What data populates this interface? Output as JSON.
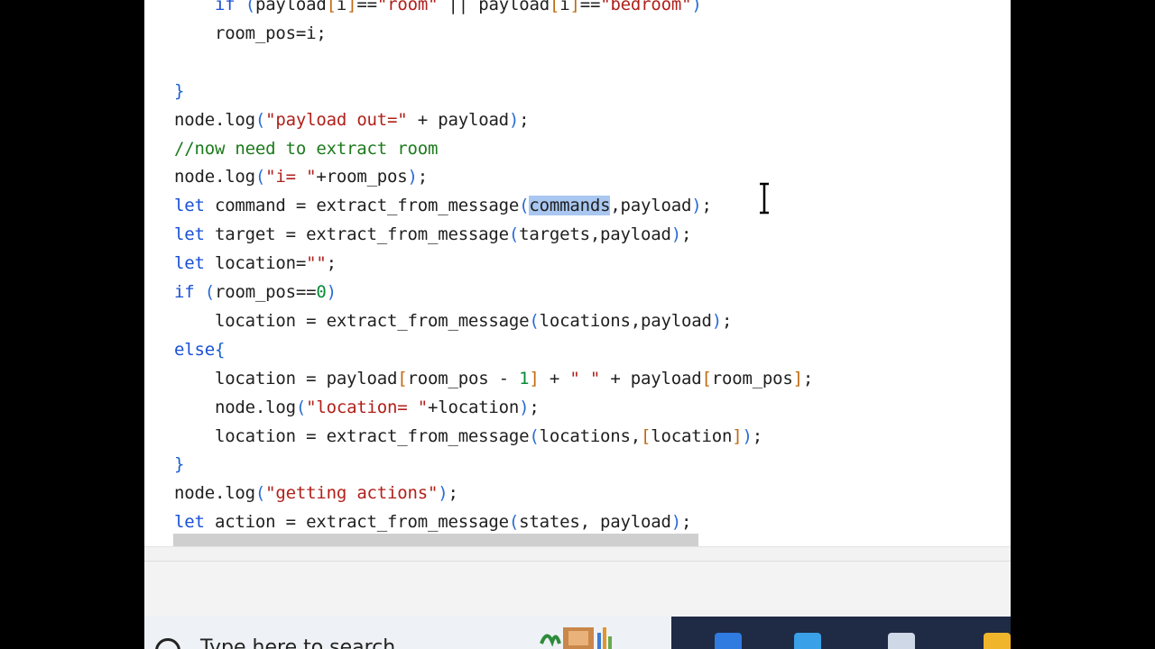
{
  "editor": {
    "lines": [
      [
        {
          "t": "    "
        },
        {
          "t": "if",
          "c": "kw"
        },
        {
          "t": " "
        },
        {
          "t": "(",
          "c": "brk"
        },
        {
          "t": "payload"
        },
        {
          "t": "[",
          "c": "par"
        },
        {
          "t": "i"
        },
        {
          "t": "]",
          "c": "par"
        },
        {
          "t": "=="
        },
        {
          "t": "\"room\"",
          "c": "str"
        },
        {
          "t": " || "
        },
        {
          "t": "payload"
        },
        {
          "t": "[",
          "c": "par"
        },
        {
          "t": "i"
        },
        {
          "t": "]",
          "c": "par"
        },
        {
          "t": "=="
        },
        {
          "t": "\"bedroom\"",
          "c": "str"
        },
        {
          "t": ")",
          "c": "brk"
        }
      ],
      [
        {
          "t": "    room_pos=i;"
        }
      ],
      [
        {
          "t": ""
        }
      ],
      [
        {
          "t": "}",
          "c": "brc"
        }
      ],
      [
        {
          "t": "node.log"
        },
        {
          "t": "(",
          "c": "brk"
        },
        {
          "t": "\"payload out=\"",
          "c": "str"
        },
        {
          "t": " + payload"
        },
        {
          "t": ")",
          "c": "brk"
        },
        {
          "t": ";"
        }
      ],
      [
        {
          "t": "//now need to extract room",
          "c": "cmt"
        }
      ],
      [
        {
          "t": "node.log"
        },
        {
          "t": "(",
          "c": "brk"
        },
        {
          "t": "\"i= \"",
          "c": "str"
        },
        {
          "t": "+room_pos"
        },
        {
          "t": ")",
          "c": "brk"
        },
        {
          "t": ";"
        }
      ],
      [
        {
          "t": "let",
          "c": "kw"
        },
        {
          "t": " command = extract_from_message"
        },
        {
          "t": "(",
          "c": "brk"
        },
        {
          "t": "commands",
          "c": "sel"
        },
        {
          "t": ",payload"
        },
        {
          "t": ")",
          "c": "brk"
        },
        {
          "t": ";"
        }
      ],
      [
        {
          "t": "let",
          "c": "kw"
        },
        {
          "t": " target = extract_from_message"
        },
        {
          "t": "(",
          "c": "brk"
        },
        {
          "t": "targets,payload"
        },
        {
          "t": ")",
          "c": "brk"
        },
        {
          "t": ";"
        }
      ],
      [
        {
          "t": "let",
          "c": "kw"
        },
        {
          "t": " location="
        },
        {
          "t": "\"\"",
          "c": "str"
        },
        {
          "t": ";"
        }
      ],
      [
        {
          "t": "if",
          "c": "kw"
        },
        {
          "t": " "
        },
        {
          "t": "(",
          "c": "brk"
        },
        {
          "t": "room_pos=="
        },
        {
          "t": "0",
          "c": "num"
        },
        {
          "t": ")",
          "c": "brk"
        }
      ],
      [
        {
          "t": "    location = extract_from_message"
        },
        {
          "t": "(",
          "c": "brk"
        },
        {
          "t": "locations,payload"
        },
        {
          "t": ")",
          "c": "brk"
        },
        {
          "t": ";"
        }
      ],
      [
        {
          "t": "else",
          "c": "kw"
        },
        {
          "t": "{",
          "c": "brc"
        }
      ],
      [
        {
          "t": "    location = payload"
        },
        {
          "t": "[",
          "c": "par"
        },
        {
          "t": "room_pos - "
        },
        {
          "t": "1",
          "c": "num"
        },
        {
          "t": "]",
          "c": "par"
        },
        {
          "t": " + "
        },
        {
          "t": "\" \"",
          "c": "str"
        },
        {
          "t": " + payload"
        },
        {
          "t": "[",
          "c": "par"
        },
        {
          "t": "room_pos"
        },
        {
          "t": "]",
          "c": "par"
        },
        {
          "t": ";"
        }
      ],
      [
        {
          "t": "    node.log"
        },
        {
          "t": "(",
          "c": "brk"
        },
        {
          "t": "\"location= \"",
          "c": "str"
        },
        {
          "t": "+location"
        },
        {
          "t": ")",
          "c": "brk"
        },
        {
          "t": ";"
        }
      ],
      [
        {
          "t": "    location = extract_from_message"
        },
        {
          "t": "(",
          "c": "brk"
        },
        {
          "t": "locations,"
        },
        {
          "t": "[",
          "c": "par"
        },
        {
          "t": "location"
        },
        {
          "t": "]",
          "c": "par"
        },
        {
          "t": ")",
          "c": "brk"
        },
        {
          "t": ";"
        }
      ],
      [
        {
          "t": "}",
          "c": "brc"
        }
      ],
      [
        {
          "t": "node.log"
        },
        {
          "t": "(",
          "c": "brk"
        },
        {
          "t": "\"getting actions\"",
          "c": "str"
        },
        {
          "t": ")",
          "c": "brk"
        },
        {
          "t": ";"
        }
      ],
      [
        {
          "t": "let",
          "c": "kw"
        },
        {
          "t": " action = extract_from_message"
        },
        {
          "t": "(",
          "c": "brk"
        },
        {
          "t": "states, payload"
        },
        {
          "t": ")",
          "c": "brk"
        },
        {
          "t": ";"
        }
      ]
    ]
  },
  "taskbar": {
    "search_text": "Type here to search"
  },
  "colors": {
    "keyword": "#1a4fd6",
    "string": "#b0201a",
    "number": "#0a8a3a",
    "comment": "#1c7a1c",
    "selection": "#a9c7f0",
    "taskbar_dark": "#1f2a44"
  },
  "icons": [
    "text-cursor-icon",
    "search-icon",
    "widgets-icon",
    "copilot-icon",
    "store-icon",
    "app-icon",
    "file-explorer-icon"
  ]
}
